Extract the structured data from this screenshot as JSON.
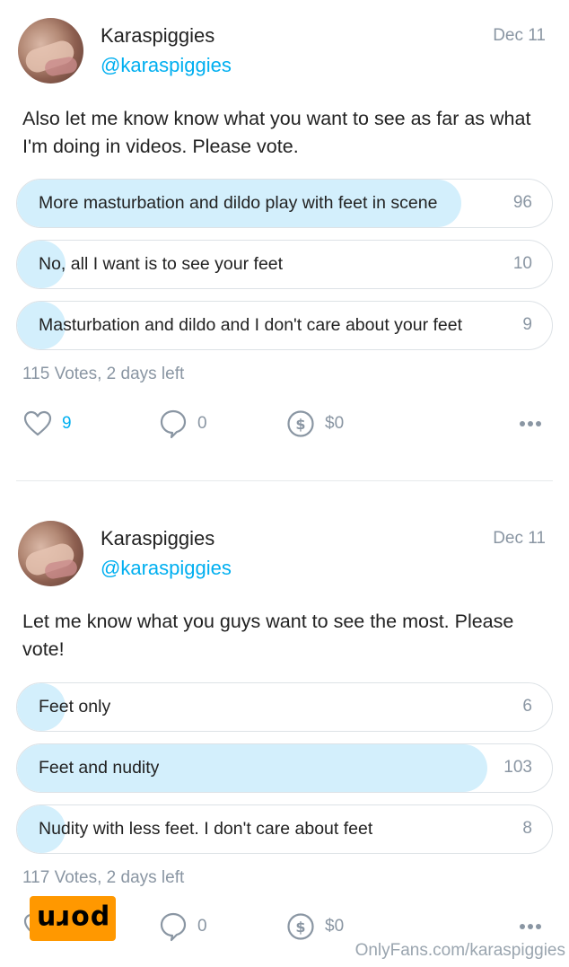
{
  "posts": [
    {
      "author": "Karaspiggies",
      "handle": "@karaspiggies",
      "date": "Dec 11",
      "text": "Also let me know know what you want to see as far as what I'm doing in videos. Please vote.",
      "poll": {
        "options": [
          {
            "label": "More masturbation and dildo play with feet in scene",
            "count": "96",
            "fraction": 0.83
          },
          {
            "label": "No, all I want is to see your feet",
            "count": "10",
            "fraction": 0.09
          },
          {
            "label": "Masturbation and dildo and I don't care about your feet",
            "count": "9",
            "fraction": 0.08
          }
        ],
        "votes": "115 Votes",
        "time_left": ", 2 days left"
      },
      "likes": "9",
      "comments": "0",
      "tips": "$0"
    },
    {
      "author": "Karaspiggies",
      "handle": "@karaspiggies",
      "date": "Dec 11",
      "text": "Let me know what you guys want to see the most. Please vote!",
      "poll": {
        "options": [
          {
            "label": "Feet only",
            "count": "6",
            "fraction": 0.05
          },
          {
            "label": "Feet and nudity",
            "count": "103",
            "fraction": 0.88
          },
          {
            "label": "Nudity with less feet. I don't care about feet",
            "count": "8",
            "fraction": 0.07
          }
        ],
        "votes": "117 Votes",
        "time_left": ", 2 days left"
      },
      "likes": "",
      "comments": "0",
      "tips": "$0"
    }
  ],
  "overlay_logo": "porn",
  "watermark": "OnlyFans.com/karaspiggies",
  "colors": {
    "accent": "#00aff0",
    "poll_fill": "#d3effc",
    "muted": "#8a96a3",
    "logo_bg": "#ff9800"
  }
}
